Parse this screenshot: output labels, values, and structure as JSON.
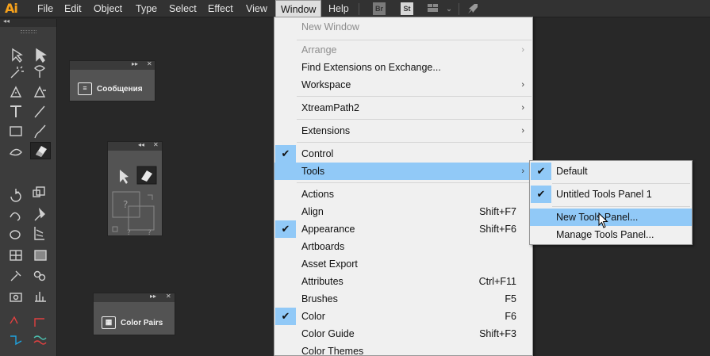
{
  "app": {
    "logo": "Ai"
  },
  "menubar": {
    "items": [
      {
        "label": "File"
      },
      {
        "label": "Edit"
      },
      {
        "label": "Object"
      },
      {
        "label": "Type"
      },
      {
        "label": "Select"
      },
      {
        "label": "Effect"
      },
      {
        "label": "View"
      },
      {
        "label": "Window"
      },
      {
        "label": "Help"
      }
    ],
    "bridge_label": "Br",
    "stock_label": "St"
  },
  "panels": {
    "messages": {
      "label": "Сообщения"
    },
    "color_pairs": {
      "label": "Color Pairs"
    },
    "mini_tools": {
      "unknown_glyph": "?"
    }
  },
  "window_menu": {
    "items": [
      {
        "label": "New Window",
        "disabled": true
      },
      {
        "label": "Arrange",
        "disabled": true,
        "submenu": true
      },
      {
        "label": "Find Extensions on Exchange..."
      },
      {
        "label": "Workspace",
        "submenu": true
      },
      {
        "label": "XtreamPath2",
        "submenu": true
      },
      {
        "label": "Extensions",
        "submenu": true
      },
      {
        "label": "Control",
        "checked": true
      },
      {
        "label": "Tools",
        "submenu": true,
        "highlighted": true
      },
      {
        "label": "Actions"
      },
      {
        "label": "Align",
        "shortcut": "Shift+F7"
      },
      {
        "label": "Appearance",
        "shortcut": "Shift+F6",
        "checked": true
      },
      {
        "label": "Artboards"
      },
      {
        "label": "Asset Export"
      },
      {
        "label": "Attributes",
        "shortcut": "Ctrl+F11"
      },
      {
        "label": "Brushes",
        "shortcut": "F5"
      },
      {
        "label": "Color",
        "shortcut": "F6",
        "checked": true
      },
      {
        "label": "Color Guide",
        "shortcut": "Shift+F3"
      },
      {
        "label": "Color Themes"
      }
    ]
  },
  "tools_submenu": {
    "items": [
      {
        "label": "Default",
        "checked": true
      },
      {
        "label": "Untitled Tools Panel 1",
        "checked": true
      },
      {
        "label": "New Tools Panel...",
        "highlighted": true
      },
      {
        "label": "Manage Tools Panel..."
      }
    ]
  },
  "colors": {
    "accent_highlight": "#91c9f7",
    "menu_background": "#f0f0f0",
    "workspace_background": "#282828",
    "logo_color": "#f7a21c"
  }
}
